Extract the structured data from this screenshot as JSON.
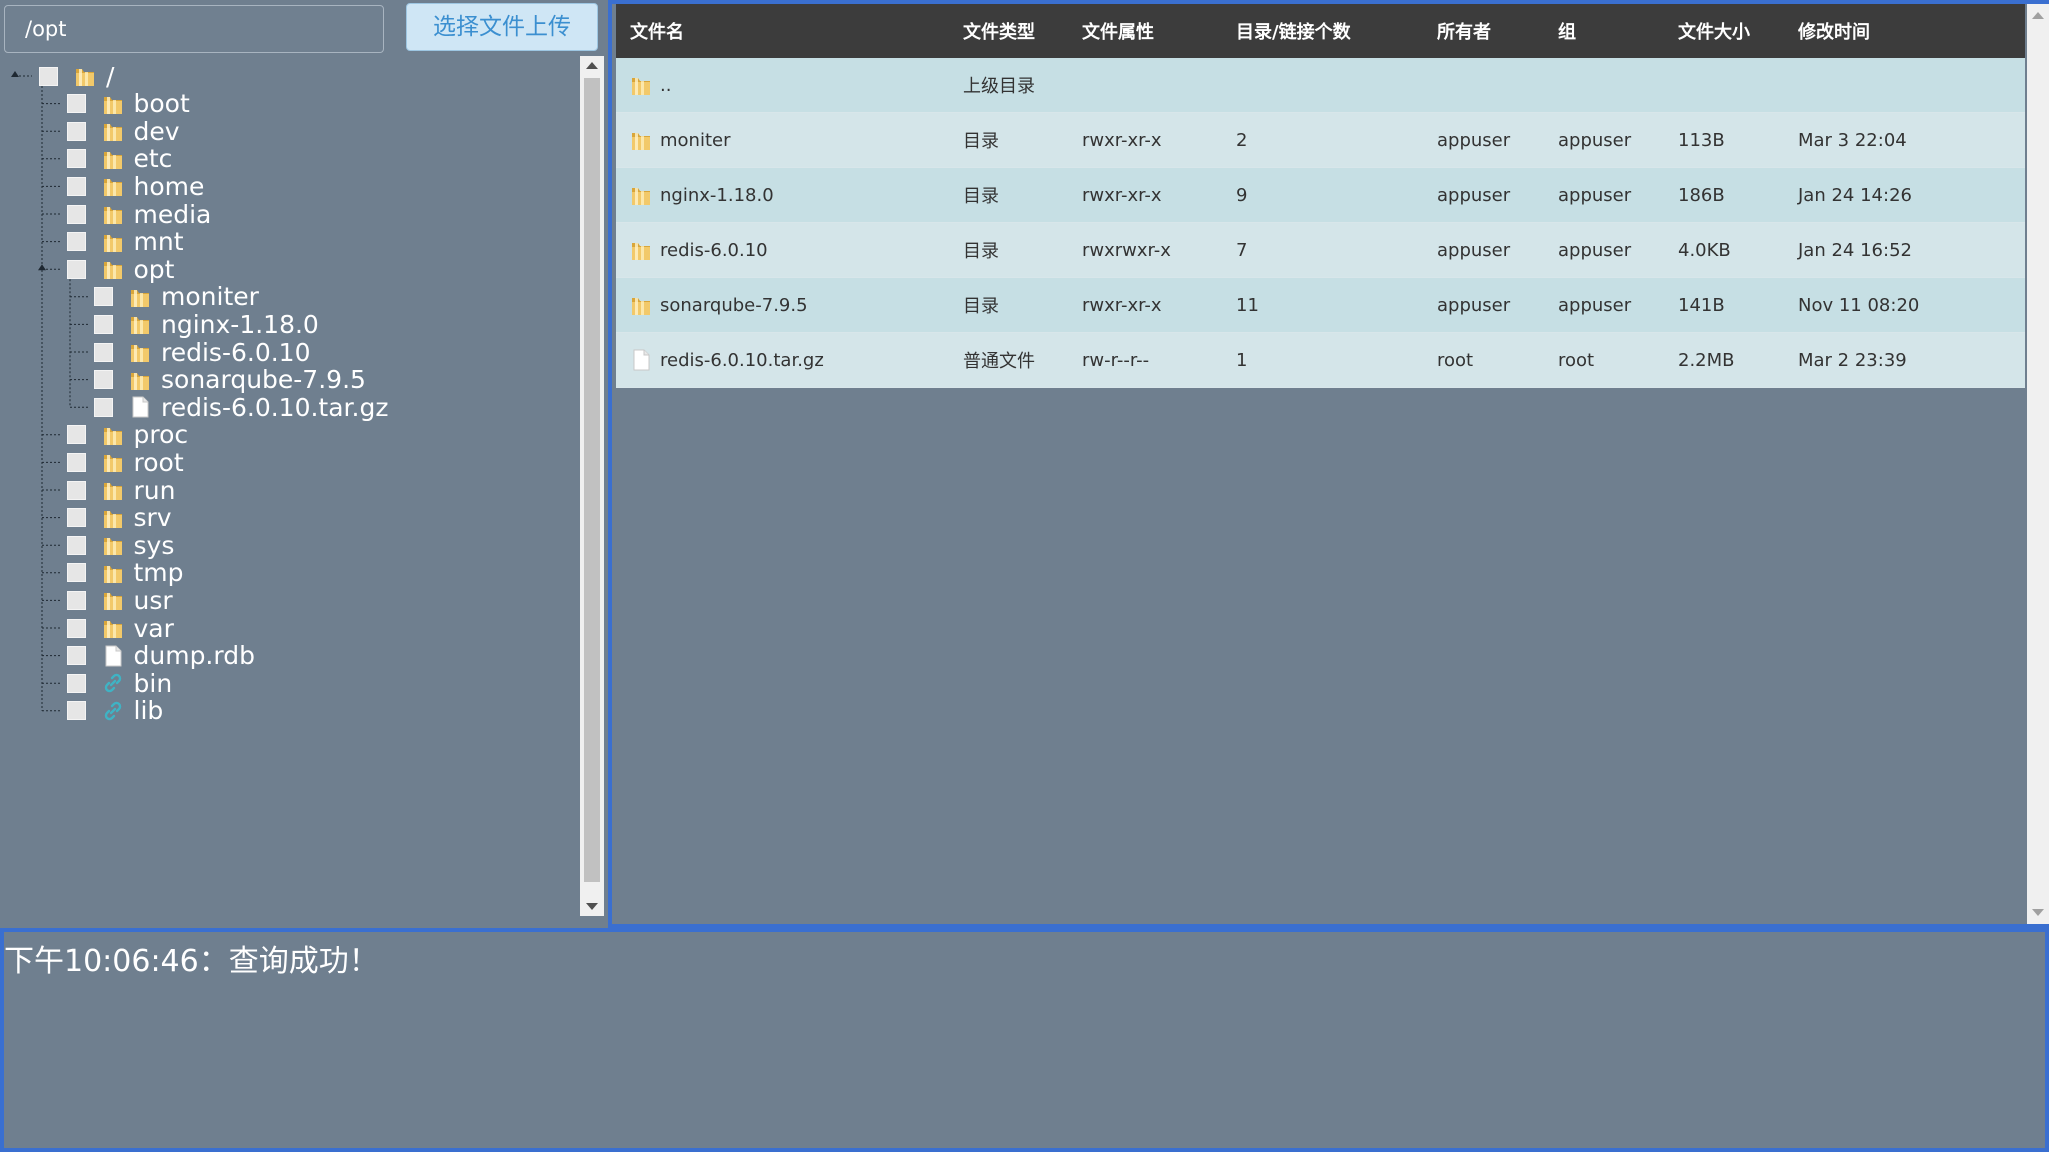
{
  "path_input": {
    "value": "/opt"
  },
  "upload_button": {
    "label": "选择文件上传"
  },
  "tree": {
    "root": {
      "label": "/",
      "type": "folder"
    },
    "children": [
      {
        "label": "boot",
        "type": "folder"
      },
      {
        "label": "dev",
        "type": "folder"
      },
      {
        "label": "etc",
        "type": "folder"
      },
      {
        "label": "home",
        "type": "folder"
      },
      {
        "label": "media",
        "type": "folder"
      },
      {
        "label": "mnt",
        "type": "folder"
      },
      {
        "label": "opt",
        "type": "folder",
        "expanded": true
      },
      {
        "label": "proc",
        "type": "folder"
      },
      {
        "label": "root",
        "type": "folder"
      },
      {
        "label": "run",
        "type": "folder"
      },
      {
        "label": "srv",
        "type": "folder"
      },
      {
        "label": "sys",
        "type": "folder"
      },
      {
        "label": "tmp",
        "type": "folder"
      },
      {
        "label": "usr",
        "type": "folder"
      },
      {
        "label": "var",
        "type": "folder"
      },
      {
        "label": "dump.rdb",
        "type": "file"
      },
      {
        "label": "bin",
        "type": "link"
      },
      {
        "label": "lib",
        "type": "link"
      }
    ],
    "opt_children": [
      {
        "label": "moniter",
        "type": "folder"
      },
      {
        "label": "nginx-1.18.0",
        "type": "folder"
      },
      {
        "label": "redis-6.0.10",
        "type": "folder"
      },
      {
        "label": "sonarqube-7.9.5",
        "type": "folder"
      },
      {
        "label": "redis-6.0.10.tar.gz",
        "type": "file"
      }
    ]
  },
  "file_table": {
    "headers": [
      "文件名",
      "文件类型",
      "文件属性",
      "目录/链接个数",
      "所有者",
      "组",
      "文件大小",
      "修改时间"
    ],
    "rows": [
      {
        "icon": "folder",
        "name": "..",
        "type": "上级目录",
        "attr": "",
        "links": "",
        "owner": "",
        "group": "",
        "size": "",
        "mtime": ""
      },
      {
        "icon": "folder",
        "name": "moniter",
        "type": "目录",
        "attr": "rwxr-xr-x",
        "links": "2",
        "owner": "appuser",
        "group": "appuser",
        "size": "113B",
        "mtime": "Mar 3 22:04"
      },
      {
        "icon": "folder",
        "name": "nginx-1.18.0",
        "type": "目录",
        "attr": "rwxr-xr-x",
        "links": "9",
        "owner": "appuser",
        "group": "appuser",
        "size": "186B",
        "mtime": "Jan 24 14:26"
      },
      {
        "icon": "folder",
        "name": "redis-6.0.10",
        "type": "目录",
        "attr": "rwxrwxr-x",
        "links": "7",
        "owner": "appuser",
        "group": "appuser",
        "size": "4.0KB",
        "mtime": "Jan 24 16:52"
      },
      {
        "icon": "folder",
        "name": "sonarqube-7.9.5",
        "type": "目录",
        "attr": "rwxr-xr-x",
        "links": "11",
        "owner": "appuser",
        "group": "appuser",
        "size": "141B",
        "mtime": "Nov 11 08:20"
      },
      {
        "icon": "file",
        "name": "redis-6.0.10.tar.gz",
        "type": "普通文件",
        "attr": "rw-r--r--",
        "links": "1",
        "owner": "root",
        "group": "root",
        "size": "2.2MB",
        "mtime": "Mar 2 23:39"
      }
    ]
  },
  "status": {
    "message": "下午10:06:46：查询成功！"
  },
  "colors": {
    "background": "#6f7f8f",
    "panel_border": "#3a6fd0",
    "table_header": "#3c3c3c",
    "row_odd": "#c6dfe4",
    "row_even": "#d4e5e9",
    "folder_icon": "#e8b64c",
    "link_icon": "#3fb3c4",
    "upload_text": "#3b8fd0"
  }
}
